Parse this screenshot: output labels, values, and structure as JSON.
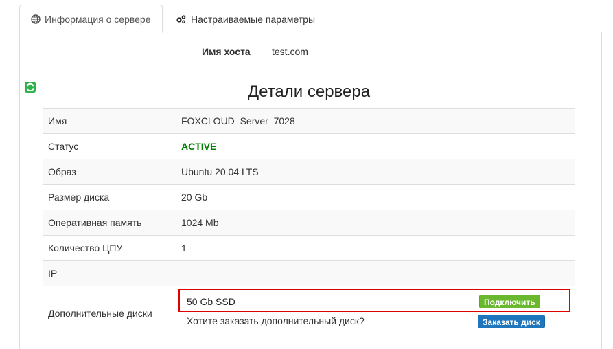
{
  "tabs": [
    {
      "label": "Информация о сервере",
      "icon": "globe-icon",
      "active": true
    },
    {
      "label": "Настраиваемые параметры",
      "icon": "cogs-icon",
      "active": false
    }
  ],
  "host": {
    "label": "Имя хоста",
    "value": "test.com"
  },
  "details": {
    "title": "Детали сервера",
    "rows": [
      {
        "label": "Имя",
        "value": "FOXCLOUD_Server_7028"
      },
      {
        "label": "Статус",
        "value": "ACTIVE"
      },
      {
        "label": "Образ",
        "value": "Ubuntu 20.04 LTS"
      },
      {
        "label": "Размер диска",
        "value": "20 Gb"
      },
      {
        "label": "Оперативная память",
        "value": "1024 Mb"
      },
      {
        "label": "Количество ЦПУ",
        "value": "1"
      },
      {
        "label": "IP",
        "value": ""
      }
    ],
    "disks": {
      "label": "Дополнительные диски",
      "disk_name": "50 Gb SSD",
      "connect_label": "Подключить",
      "order_text": "Хотите заказать дополнительный диск?",
      "order_label": "Заказать диск"
    }
  },
  "colors": {
    "status_active": "#008000",
    "connect_button": "#6ab82e",
    "order_button": "#1f76bc",
    "highlight": "#e00000",
    "refresh_icon": "#2db24a"
  }
}
